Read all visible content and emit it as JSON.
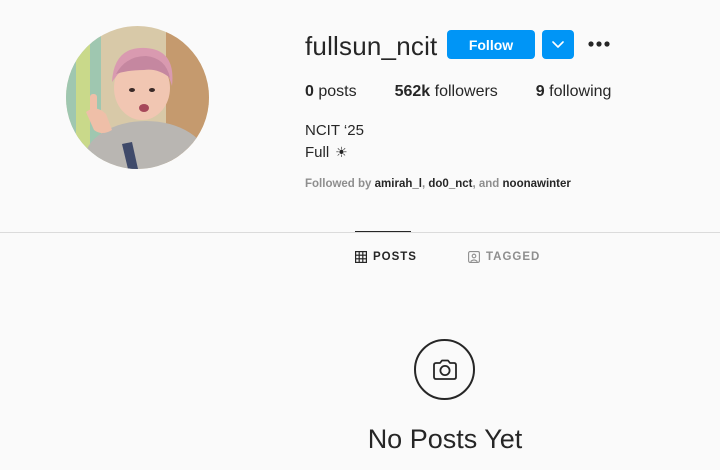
{
  "profile": {
    "username": "fullsun_ncit",
    "follow_label": "Follow",
    "stats": {
      "posts_count": "0",
      "posts_label": "posts",
      "followers_count": "562k",
      "followers_label": "followers",
      "following_count": "9",
      "following_label": "following"
    },
    "bio": {
      "name": "NCIT ‘25",
      "text": "Full",
      "emoji": "☀"
    },
    "followed_by": {
      "prefix": "Followed by",
      "user1": "amirah_l",
      "sep": ",",
      "user2": "do0_nct",
      "and": ", and",
      "user3": "noonawinter"
    }
  },
  "tabs": [
    {
      "label": "POSTS",
      "icon": "grid-icon",
      "active": true
    },
    {
      "label": "TAGGED",
      "icon": "tagged-icon",
      "active": false
    }
  ],
  "empty_state": {
    "icon": "camera-icon",
    "title": "No Posts Yet"
  },
  "colors": {
    "accent": "#0095f6",
    "background": "#fafafa",
    "text": "#262626",
    "muted": "#8e8e8e",
    "divider": "#dbdbdb"
  }
}
